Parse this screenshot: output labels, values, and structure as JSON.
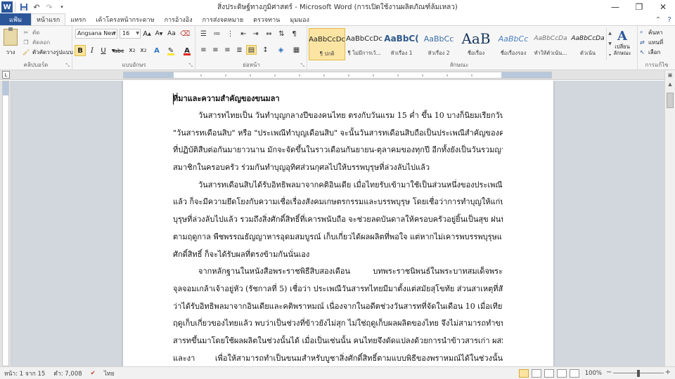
{
  "window": {
    "title": "สิ่งประดิษฐ์ทางภูมิศาสตร์ - Microsoft Word (การเปิดใช้งานผลิตภัณฑ์ล้มเหลว)"
  },
  "quick_access": {
    "app_icon": "W"
  },
  "tabs": {
    "file": "แฟ้ม",
    "items": [
      "หน้าแรก",
      "แทรก",
      "เค้าโครงหน้ากระดาษ",
      "การอ้างอิง",
      "การส่งจดหมาย",
      "ตรวจทาน",
      "มุมมอง"
    ],
    "active_index": 0
  },
  "ribbon": {
    "clipboard": {
      "label": "คลิปบอร์ด",
      "paste": "วาง",
      "cut": "ตัด",
      "copy": "คัดลอก",
      "format_painter": "ตัวคัดวางรูปแบบ"
    },
    "font": {
      "label": "แบบอักษร",
      "font_name": "Angsana New (",
      "font_size": "16"
    },
    "paragraph": {
      "label": "ย่อหน้า"
    },
    "styles": {
      "label": "ลักษณะ",
      "items": [
        {
          "sample": "AaBbCcDc",
          "name": "¶ ปกติ"
        },
        {
          "sample": "AaBbCcDc",
          "name": "¶ ไม่มีการเว้..."
        },
        {
          "sample": "AaBbC(",
          "name": "หัวเรื่อง 1"
        },
        {
          "sample": "AaBbCc",
          "name": "หัวเรื่อง 2"
        },
        {
          "sample": "AaB",
          "name": "ชื่อเรื่อง"
        },
        {
          "sample": "AaBbCc",
          "name": "ชื่อเรื่องรอง"
        },
        {
          "sample": "AaBbCcDa",
          "name": "ทำให้ตัวเน้น..."
        },
        {
          "sample": "AaBbCcDa",
          "name": "ตัวเน้น"
        }
      ],
      "selected_index": 0,
      "change_styles": "เปลี่ยน ลักษณะ"
    },
    "editing": {
      "label": "การแก้ไข",
      "find": "ค้นหา",
      "replace": "แทนที่",
      "select": "เลือก"
    },
    "colors": {
      "highlight": "#f7e43a",
      "font_color": "#e0261f"
    }
  },
  "document": {
    "heading": "ที่มาและความสำคัญของขนมลา",
    "lines": [
      {
        "text": "วันสารทไทยเป็น วันทำบุญกลางปีของคนไทย ตรงกับวันแรม 15 ค่ำ ขึ้น 10 บางก็นิยมเรียกวันนี้ว่า",
        "indent": true,
        "last": false
      },
      {
        "text": "\"วันสารทเดือนสิบ\" หรือ \"ประเพณีทำบุญเดือนสิบ\" จะนั้นวันสารทเดือนสิบถือเป็นประเพณีสำคัญของคนไทย",
        "indent": false,
        "last": false
      },
      {
        "text": "ที่ปฏิบัติสืบต่อกันมายาวนาน มักจะจัดขึ้นในราวเดือนกันยายน-ตุลาคมของทุกปี อีกทั้งยังเป็นวันรวมญาติที่",
        "indent": false,
        "last": false
      },
      {
        "text": "สมาชิกในครอบครัว ร่วมกันทำบุญอุทิศส่วนกุศลไปให้บรรพบุรุษที่ล่วงลับไปแล้ว",
        "indent": false,
        "last": true
      },
      {
        "text": "วันสารทเดือนสิบได้รับอิทธิพลมาจากคติอินเดีย เมื่อไทยรับเข้ามาใช้เป็นส่วนหนึ่งของประเพณีท้องถิ่น",
        "indent": true,
        "last": false
      },
      {
        "text": "แล้ว ก็จะมีความยึดโยงกับความเชื่อเรื่องสังคมเกษตรกรรมและบรรพบุรุษ โดยเชื่อว่าการทำบุญให้แก่บรรพ",
        "indent": false,
        "last": false
      },
      {
        "text": "บุรุษที่ล่วงลับไปแล้ว รวมถึงสิ่งศักดิ์สิทธิ์ที่เคารพนับถือ จะช่วยลดบันดาลให้ครอบครัวอยู่ยิ้นเป็นสุข ฝนฟ้าตก",
        "indent": false,
        "last": false
      },
      {
        "text": "ตามฤดูกาล พืชพรรณธัญญาหารอุดมสมบูรณ์ เก็บเกี่ยวได้ผลผลิตที่พอใจ แต่หากไม่เคารพบรรพบุรุษและสิ่ง",
        "indent": false,
        "last": false
      },
      {
        "text": "ศักดิ์สิทธิ์ ก็จะได้รับผลที่ตรงข้ามกันนั่นเอง",
        "indent": false,
        "last": true
      },
      {
        "text": "จากหลักฐานในหนังสือพระราชพิธีสิบสองเดือน บทพระราชนิพนธ์ในพระบาทสมเด็จพระ",
        "indent": true,
        "last": false
      },
      {
        "text": "จุลจอมเกล้าเจ้าอยู่หัว (รัชกาลที่ 5) เชื่อว่า ประเพณีวันสารทไทยมีมาตั้งแต่สมัยสุโขทัย ส่วนสาเหตุที่สันนิษฐาน",
        "indent": false,
        "last": false
      },
      {
        "text": "ว่าได้รับอิทธิพลมาจากอินเดียและคติพราหมณ์ เนื่องจากในอดีตช่วงวันสารทที่จัดในเดือน 10 เมื่อเทียบกับช่วง",
        "indent": false,
        "last": false
      },
      {
        "text": "ฤดูเก็บเกี่ยวของไทยแล้ว พบว่าเป็นช่วงที่ข้าวยังไม่สุก ไม่ใช่ฤดูเก็บผลผลิตของไทย จึงไม่สามารถทำขนมกระยา",
        "indent": false,
        "last": false
      },
      {
        "text": "สารทขึ้นมาโดยใช้ผลผลิตในช่วงนั้นได้ เมื่อเป็นเช่นนั้น คนไทยจึงดัดแปลงด้วยการนำข้าวสารเก่า ผสมกับถั่ว",
        "indent": false,
        "last": false
      },
      {
        "text": "และงา เพื่อให้สามารถทำเป็นขนมสำหรับบูชาสิ่งศักดิ์สิทธิ์ตามแบบพิธีของพราหมณ์ได้ในช่วงนั้น",
        "indent": false,
        "last": false
      }
    ]
  },
  "status_bar": {
    "page": "หน้า: 1 จาก 15",
    "words": "คำ: 7,008",
    "language": "ไทย",
    "zoom": "100%"
  }
}
